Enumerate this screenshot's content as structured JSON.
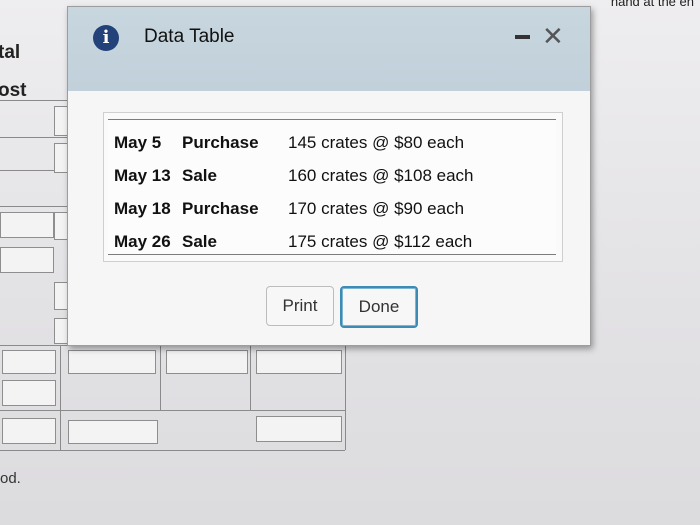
{
  "background": {
    "label_total": "tal",
    "label_cost": "ost",
    "footer_text": "od.",
    "top_right_text": "nand at the en"
  },
  "dialog": {
    "icon": "info-icon",
    "title": "Data Table",
    "rows": [
      {
        "date": "May 5",
        "type": "Purchase",
        "detail": "145 crates @ $80 each"
      },
      {
        "date": "May 13",
        "type": "Sale",
        "detail": "160 crates @ $108 each"
      },
      {
        "date": "May 18",
        "type": "Purchase",
        "detail": "170 crates @ $90 each"
      },
      {
        "date": "May 26",
        "type": "Sale",
        "detail": "175 crates @ $112 each"
      }
    ],
    "print_label": "Print",
    "done_label": "Done"
  }
}
